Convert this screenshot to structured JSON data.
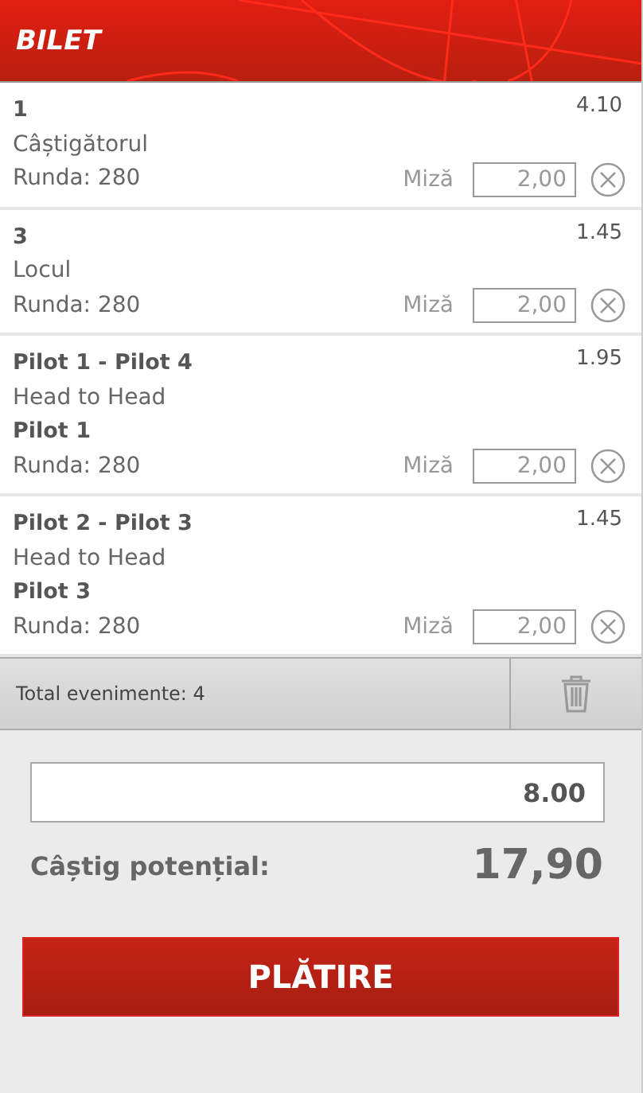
{
  "header": {
    "title": "BILET"
  },
  "bets": [
    {
      "title": "1",
      "market": "Câștigătorul",
      "round": "Runda: 280",
      "odds": "4.10",
      "stake_label": "Miză",
      "stake": "2,00"
    },
    {
      "title": "3",
      "market": "Locul",
      "round": "Runda: 280",
      "odds": "1.45",
      "stake_label": "Miză",
      "stake": "2,00"
    },
    {
      "title": "Pilot 1 - Pilot 4",
      "market": "Head to Head",
      "pick": "Pilot 1",
      "round": "Runda: 280",
      "odds": "1.95",
      "stake_label": "Miză",
      "stake": "2,00"
    },
    {
      "title": "Pilot 2 - Pilot 3",
      "market": "Head to Head",
      "pick": "Pilot 3",
      "round": "Runda: 280",
      "odds": "1.45",
      "stake_label": "Miză",
      "stake": "2,00"
    }
  ],
  "summary": {
    "total_events": "Total evenimente: 4"
  },
  "total_stake": {
    "value": "8.00"
  },
  "potential_win": {
    "label": "Câștig potențial:",
    "value": "17,90"
  },
  "pay_button": {
    "label": "PLĂTIRE"
  }
}
